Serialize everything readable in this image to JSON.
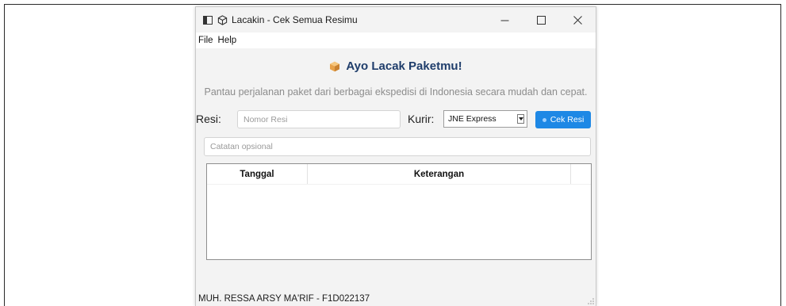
{
  "window": {
    "title": "Lacakin - Cek Semua Resimu",
    "controls": {
      "minimize": "—",
      "maximize": "☐",
      "close": "✕"
    }
  },
  "menu": {
    "items": [
      "File",
      "Help"
    ]
  },
  "header": {
    "icon": "package-icon",
    "title": "Ayo Lacak Paketmu!",
    "subtitle": "Pantau perjalanan paket dari berbagai ekspedisi di Indonesia secara mudah dan cepat."
  },
  "form": {
    "resi_label": "Resi:",
    "resi_placeholder": "Nomor Resi",
    "kurir_label": "Kurir:",
    "kurir_selected": "JNE Express",
    "submit_label": "Cek Resi",
    "note_placeholder": "Catatan opsional"
  },
  "table": {
    "columns": [
      "Tanggal",
      "Keterangan"
    ],
    "rows": []
  },
  "status": {
    "text": "MUH. RESSA ARSY MA'RIF - F1D022137"
  },
  "colors": {
    "accent": "#1e88e5",
    "heading": "#1f3d6b",
    "subtitle": "#8c8c8c",
    "package": "#e8a24a"
  }
}
